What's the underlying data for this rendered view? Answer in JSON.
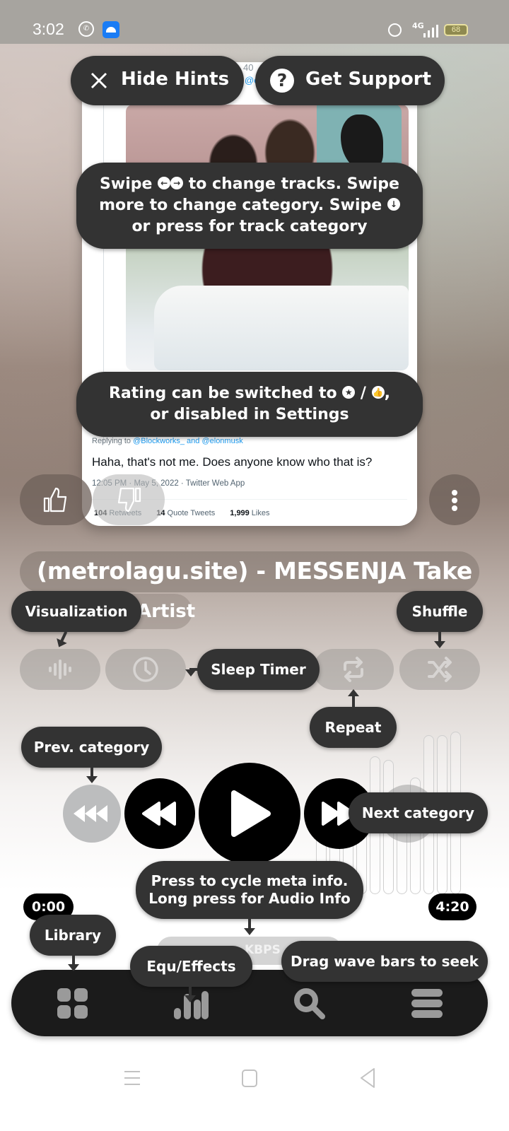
{
  "status_bar": {
    "time": "3:02",
    "network": "4G",
    "battery": "68",
    "icons": [
      "whatsapp-icon",
      "android-icon",
      "alarm-icon",
      "signal-icon",
      "battery-icon"
    ]
  },
  "album_art": {
    "tweet_handle_partial": "40",
    "tweet_mention_partial": "@e",
    "replying_prefix": "Replying to ",
    "replying_handles": "@Blockworks_ and @elonmusk",
    "tweet_text": "Haha, that's not me. Does anyone know who that is?",
    "tweet_meta": "12:05 PM · May 5, 2022 · Twitter Web App",
    "stats": [
      {
        "count": "104",
        "label": "Retweets"
      },
      {
        "count": "14",
        "label": "Quote Tweets"
      },
      {
        "count": "1,999",
        "label": "Likes"
      }
    ]
  },
  "track": {
    "title": "(metrolagu.site) - MESSENJA Take",
    "artist": "Artist",
    "elapsed": "0:00",
    "duration": "4:20",
    "meta_info": "KBPS",
    "waveform_levels": [
      0.15,
      0.55,
      0.52,
      0.6,
      0.56,
      0.78,
      0.76,
      0.49,
      0.66,
      0.9,
      0.9,
      0.92
    ]
  },
  "controls": {
    "like": "thumbs-up-icon",
    "dislike": "thumbs-down-icon",
    "more": "more-vertical-icon",
    "toggles": [
      "visualization",
      "sleep-timer",
      "repeat",
      "shuffle"
    ]
  },
  "hints": {
    "hide_hints": "Hide Hints",
    "get_support": "Get Support",
    "swipe_line1_a": "Swipe",
    "swipe_line1_b": "to change tracks. Swipe",
    "swipe_line2": "more to change category. Swipe",
    "swipe_line3": "or press for track category",
    "rating_line1": "Rating can be switched to",
    "rating_sep": "/",
    "rating_line2": "or disabled in Settings",
    "visualization": "Visualization",
    "shuffle": "Shuffle",
    "sleep_timer": "Sleep Timer",
    "repeat": "Repeat",
    "prev_category": "Prev. category",
    "next_category": "Next category",
    "meta_line1": "Press to cycle meta info.",
    "meta_line2": "Long press for Audio Info",
    "library": "Library",
    "equ_effects": "Equ/Effects",
    "drag_wave": "Drag wave bars to seek"
  },
  "bottom_nav": [
    "library",
    "equalizer",
    "search",
    "queue"
  ]
}
